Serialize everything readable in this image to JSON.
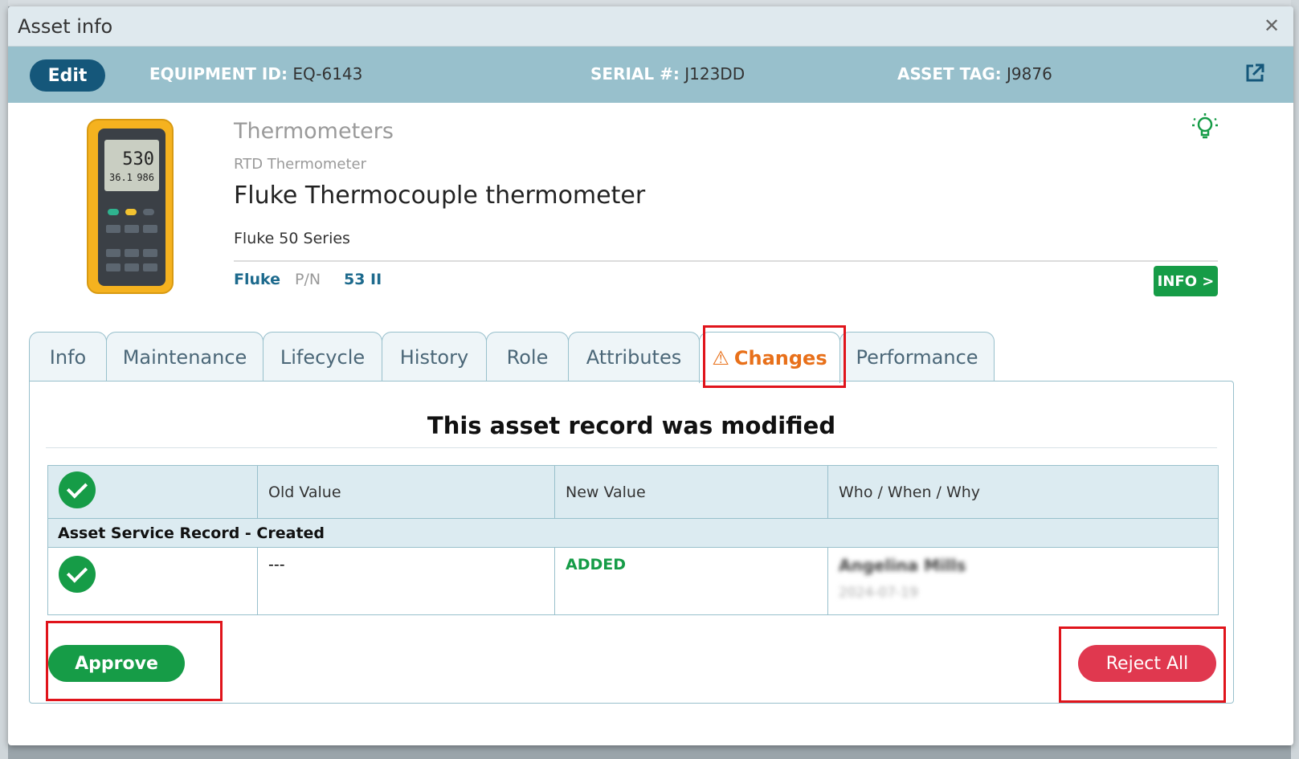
{
  "dialog": {
    "title": "Asset info"
  },
  "id_bar": {
    "edit_label": "Edit",
    "equipment_id_label": "EQUIPMENT ID:",
    "equipment_id": "EQ-6143",
    "serial_label": "SERIAL #:",
    "serial": "J123DD",
    "asset_tag_label": "ASSET TAG:",
    "asset_tag": "J9876"
  },
  "product": {
    "category": "Thermometers",
    "subtype": "RTD Thermometer",
    "name": "Fluke Thermocouple thermometer",
    "series": "Fluke 50 Series",
    "manufacturer": "Fluke",
    "pn_label": "P/N",
    "pn": "53 II",
    "info_button": "INFO >",
    "display_main": "530",
    "display_sub_left": "36.1",
    "display_sub_right": "986"
  },
  "tabs": [
    {
      "label": "Info"
    },
    {
      "label": "Maintenance"
    },
    {
      "label": "Lifecycle"
    },
    {
      "label": "History"
    },
    {
      "label": "Role"
    },
    {
      "label": "Attributes"
    },
    {
      "label": "Changes",
      "active": true,
      "icon": "warning-icon"
    },
    {
      "label": "Performance"
    }
  ],
  "changes": {
    "heading": "This asset record was modified",
    "columns": [
      "Old Value",
      "New Value",
      "Who / When / Why"
    ],
    "group": "Asset Service Record - Created",
    "rows": [
      {
        "old_value": "---",
        "new_value": "ADDED",
        "who": "Angelina Mills",
        "when": "2024-07-19"
      }
    ],
    "approve_label": "Approve",
    "reject_label": "Reject All"
  },
  "colors": {
    "accent_blue": "#15577a",
    "header_bar": "#98c0cc",
    "success_green": "#169c47",
    "danger_red": "#e0384f",
    "warning_orange": "#e8701a",
    "highlight_red": "#e0141b"
  }
}
